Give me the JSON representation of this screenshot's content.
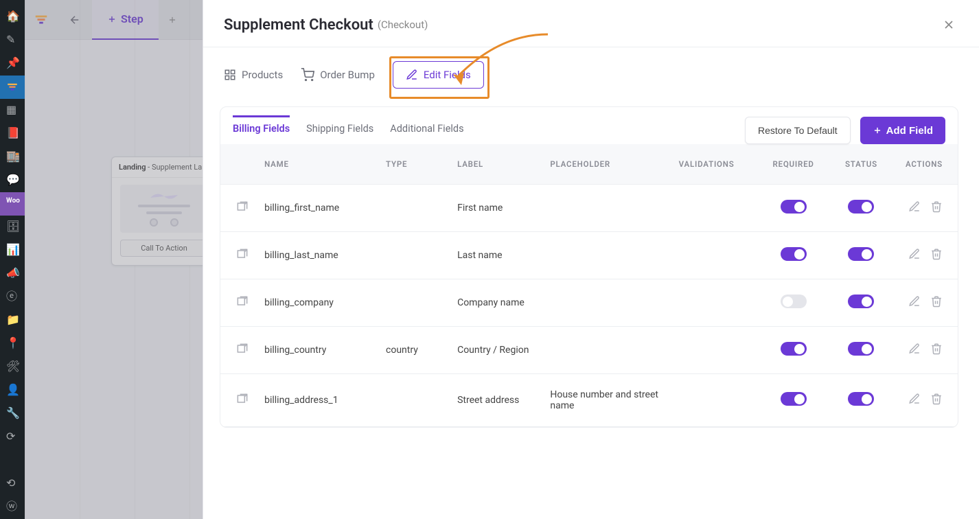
{
  "wp_sidebar": [
    {
      "name": "dashboard-icon"
    },
    {
      "name": "brush-icon"
    },
    {
      "name": "pin-icon"
    },
    {
      "name": "funnel-icon",
      "active": true
    },
    {
      "name": "blocks-icon"
    },
    {
      "name": "book-icon"
    },
    {
      "name": "store-icon"
    },
    {
      "name": "chat-icon"
    },
    {
      "name": "woo-icon"
    },
    {
      "name": "archive-icon"
    },
    {
      "name": "stats-icon"
    },
    {
      "name": "megaphone-icon"
    },
    {
      "name": "elementor-icon"
    },
    {
      "name": "folder-icon"
    },
    {
      "name": "pushpin-icon"
    },
    {
      "name": "tools-icon"
    },
    {
      "name": "user-icon"
    },
    {
      "name": "wrench-icon"
    },
    {
      "name": "updates-icon"
    },
    {
      "name": "collapse-icon"
    },
    {
      "name": "wpbar-icon"
    }
  ],
  "topbar": {
    "step_label": "Step"
  },
  "step_card": {
    "title": "Landing",
    "subtitle": "Supplement La...",
    "cta": "Call To Action"
  },
  "panel": {
    "title": "Supplement Checkout",
    "subtitle": "(Checkout)"
  },
  "tabs": {
    "products": "Products",
    "order_bump": "Order Bump",
    "edit_fields": "Edit Fields"
  },
  "card": {
    "tabs": {
      "billing": "Billing Fields",
      "shipping": "Shipping Fields",
      "additional": "Additional Fields"
    },
    "restore": "Restore To Default",
    "add": "Add Field",
    "headers": {
      "name": "NAME",
      "type": "TYPE",
      "label": "LABEL",
      "placeholder": "PLACEHOLDER",
      "validations": "VALIDATIONS",
      "required": "REQUIRED",
      "status": "STATUS",
      "actions": "ACTIONS"
    },
    "rows": [
      {
        "name": "billing_first_name",
        "type": "",
        "label": "First name",
        "placeholder": "",
        "required": true,
        "status": true
      },
      {
        "name": "billing_last_name",
        "type": "",
        "label": "Last name",
        "placeholder": "",
        "required": true,
        "status": true
      },
      {
        "name": "billing_company",
        "type": "",
        "label": "Company name",
        "placeholder": "",
        "required": false,
        "status": true
      },
      {
        "name": "billing_country",
        "type": "country",
        "label": "Country / Region",
        "placeholder": "",
        "required": true,
        "status": true
      },
      {
        "name": "billing_address_1",
        "type": "",
        "label": "Street address",
        "placeholder": "House number and street name",
        "required": true,
        "status": true
      }
    ]
  }
}
